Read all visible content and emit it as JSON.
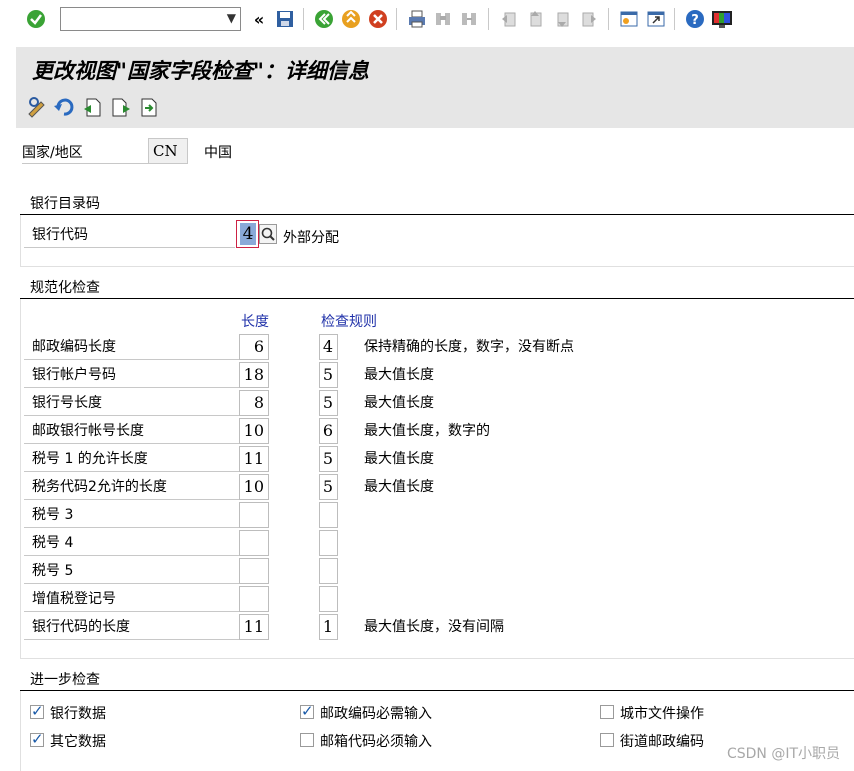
{
  "toolbar": {
    "command_value": "",
    "icons": [
      "enter-icon",
      "back-arrows-icon",
      "save-icon",
      "back-icon",
      "exit-icon",
      "cancel-icon",
      "print-icon",
      "find-icon",
      "find-next-icon",
      "first-page-icon",
      "prev-page-icon",
      "next-page-icon",
      "last-page-icon",
      "new-session-icon",
      "shortcut-icon",
      "help-icon",
      "customize-layout-icon"
    ]
  },
  "title": "更改视图\"国家字段检查\"：详细信息",
  "country": {
    "label": "国家/地区",
    "code": "CN",
    "name": "中国"
  },
  "bank_dir": {
    "title": "银行目录码",
    "field_label": "银行代码",
    "value": "4",
    "description": "外部分配"
  },
  "norm_check": {
    "title": "规范化检查",
    "col_length": "长度",
    "col_rule": "检查规则",
    "rows": [
      {
        "label": "邮政编码长度",
        "length": "6",
        "rule": "4",
        "desc": "保持精确的长度，数字，没有断点"
      },
      {
        "label": "银行帐户号码",
        "length": "18",
        "rule": "5",
        "desc": "最大值长度"
      },
      {
        "label": "银行号长度",
        "length": "8",
        "rule": "5",
        "desc": "最大值长度"
      },
      {
        "label": "邮政银行帐号长度",
        "length": "10",
        "rule": "6",
        "desc": "最大值长度，数字的"
      },
      {
        "label": "税号 1 的允许长度",
        "length": "11",
        "rule": "5",
        "desc": "最大值长度"
      },
      {
        "label": "税务代码2允许的长度",
        "length": "10",
        "rule": "5",
        "desc": "最大值长度"
      },
      {
        "label": "税号 3",
        "length": "",
        "rule": "",
        "desc": ""
      },
      {
        "label": "税号 4",
        "length": "",
        "rule": "",
        "desc": ""
      },
      {
        "label": "税号 5",
        "length": "",
        "rule": "",
        "desc": ""
      },
      {
        "label": "增值税登记号",
        "length": "",
        "rule": "",
        "desc": ""
      },
      {
        "label": "银行代码的长度",
        "length": "11",
        "rule": "1",
        "desc": "最大值长度，没有间隔"
      }
    ]
  },
  "further_check": {
    "title": "进一步检查",
    "items": [
      {
        "label": "银行数据",
        "checked": true
      },
      {
        "label": "邮政编码必需输入",
        "checked": true
      },
      {
        "label": "城市文件操作",
        "checked": false
      },
      {
        "label": "其它数据",
        "checked": true
      },
      {
        "label": "邮箱代码必须输入",
        "checked": false
      },
      {
        "label": "街道邮政编码",
        "checked": false
      }
    ]
  },
  "watermark": "CSDN @IT小职员",
  "colors": {
    "title_bg": "#e6e6e6",
    "header_blue": "#2233aa",
    "focus_red": "#cc2244"
  }
}
